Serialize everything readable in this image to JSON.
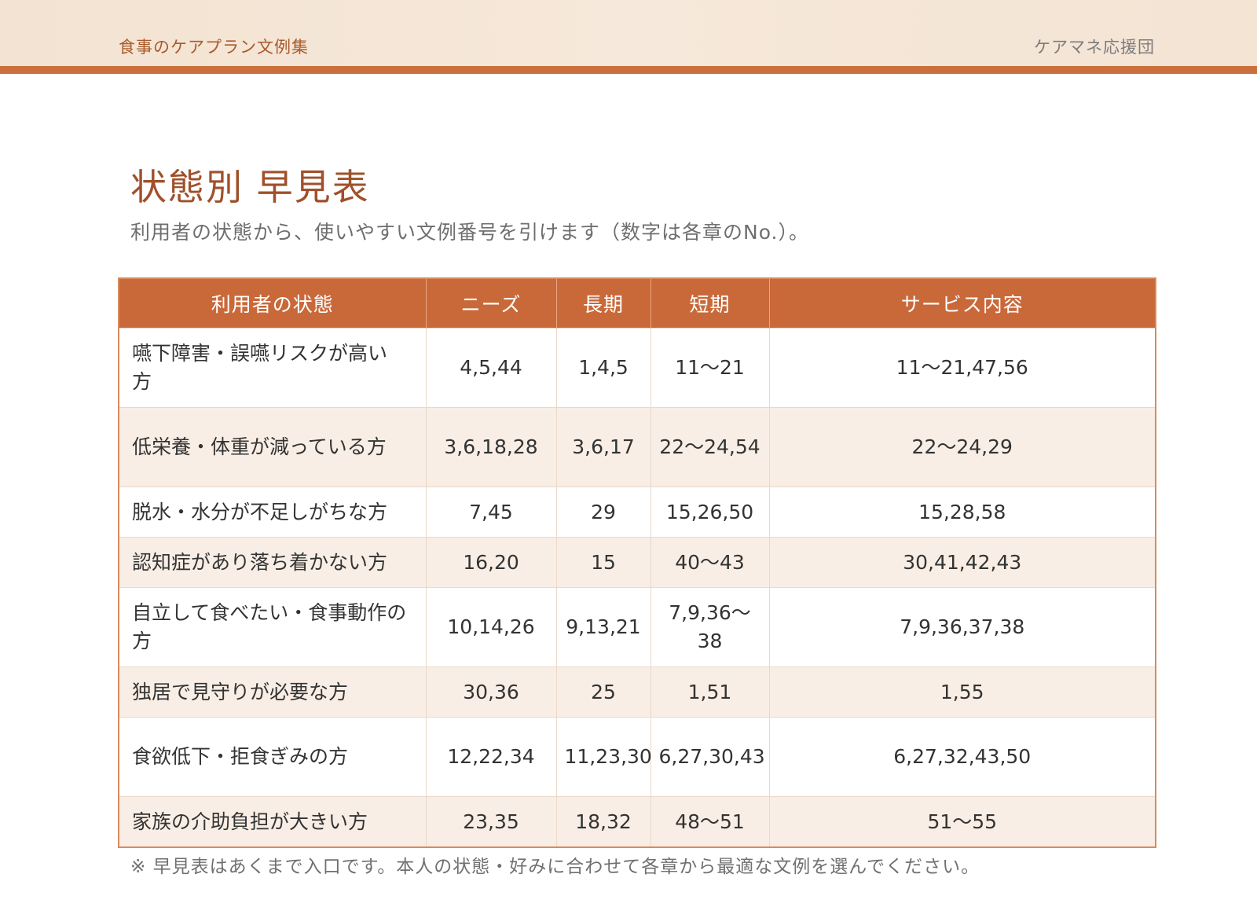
{
  "header": {
    "doc_title": "食事のケアプラン文例集",
    "organization": "ケアマネ応援団"
  },
  "page": {
    "title": "状態別 早見表",
    "subtitle": "利用者の状態から、使いやすい文例番号を引けます（数字は各章のNo.）。",
    "footnote": "※ 早見表はあくまで入口です。本人の状態・好みに合わせて各章から最適な文例を選んでください。"
  },
  "table": {
    "columns": [
      "利用者の状態",
      "ニーズ",
      "長期",
      "短期",
      "サービス内容"
    ],
    "rows": [
      [
        "嚥下障害・誤嚥リスクが高い方",
        "4,5,44",
        "1,4,5",
        "11〜21",
        "11〜21,47,56"
      ],
      [
        "低栄養・体重が減っている方",
        "3,6,18,28",
        "3,6,17",
        "22〜24,54",
        "22〜24,29"
      ],
      [
        "脱水・水分が不足しがちな方",
        "7,45",
        "29",
        "15,26,50",
        "15,28,58"
      ],
      [
        "認知症があり落ち着かない方",
        "16,20",
        "15",
        "40〜43",
        "30,41,42,43"
      ],
      [
        "自立して食べたい・食事動作の方",
        "10,14,26",
        "9,13,21",
        "7,9,36〜38",
        "7,9,36,37,38"
      ],
      [
        "独居で見守りが必要な方",
        "30,36",
        "25",
        "1,51",
        "1,55"
      ],
      [
        "食欲低下・拒食ぎみの方",
        "12,22,34",
        "11,23,30",
        "6,27,30,43",
        "6,27,32,43,50"
      ],
      [
        "家族の介助負担が大きい方",
        "23,35",
        "18,32",
        "48〜51",
        "51〜55"
      ]
    ]
  }
}
